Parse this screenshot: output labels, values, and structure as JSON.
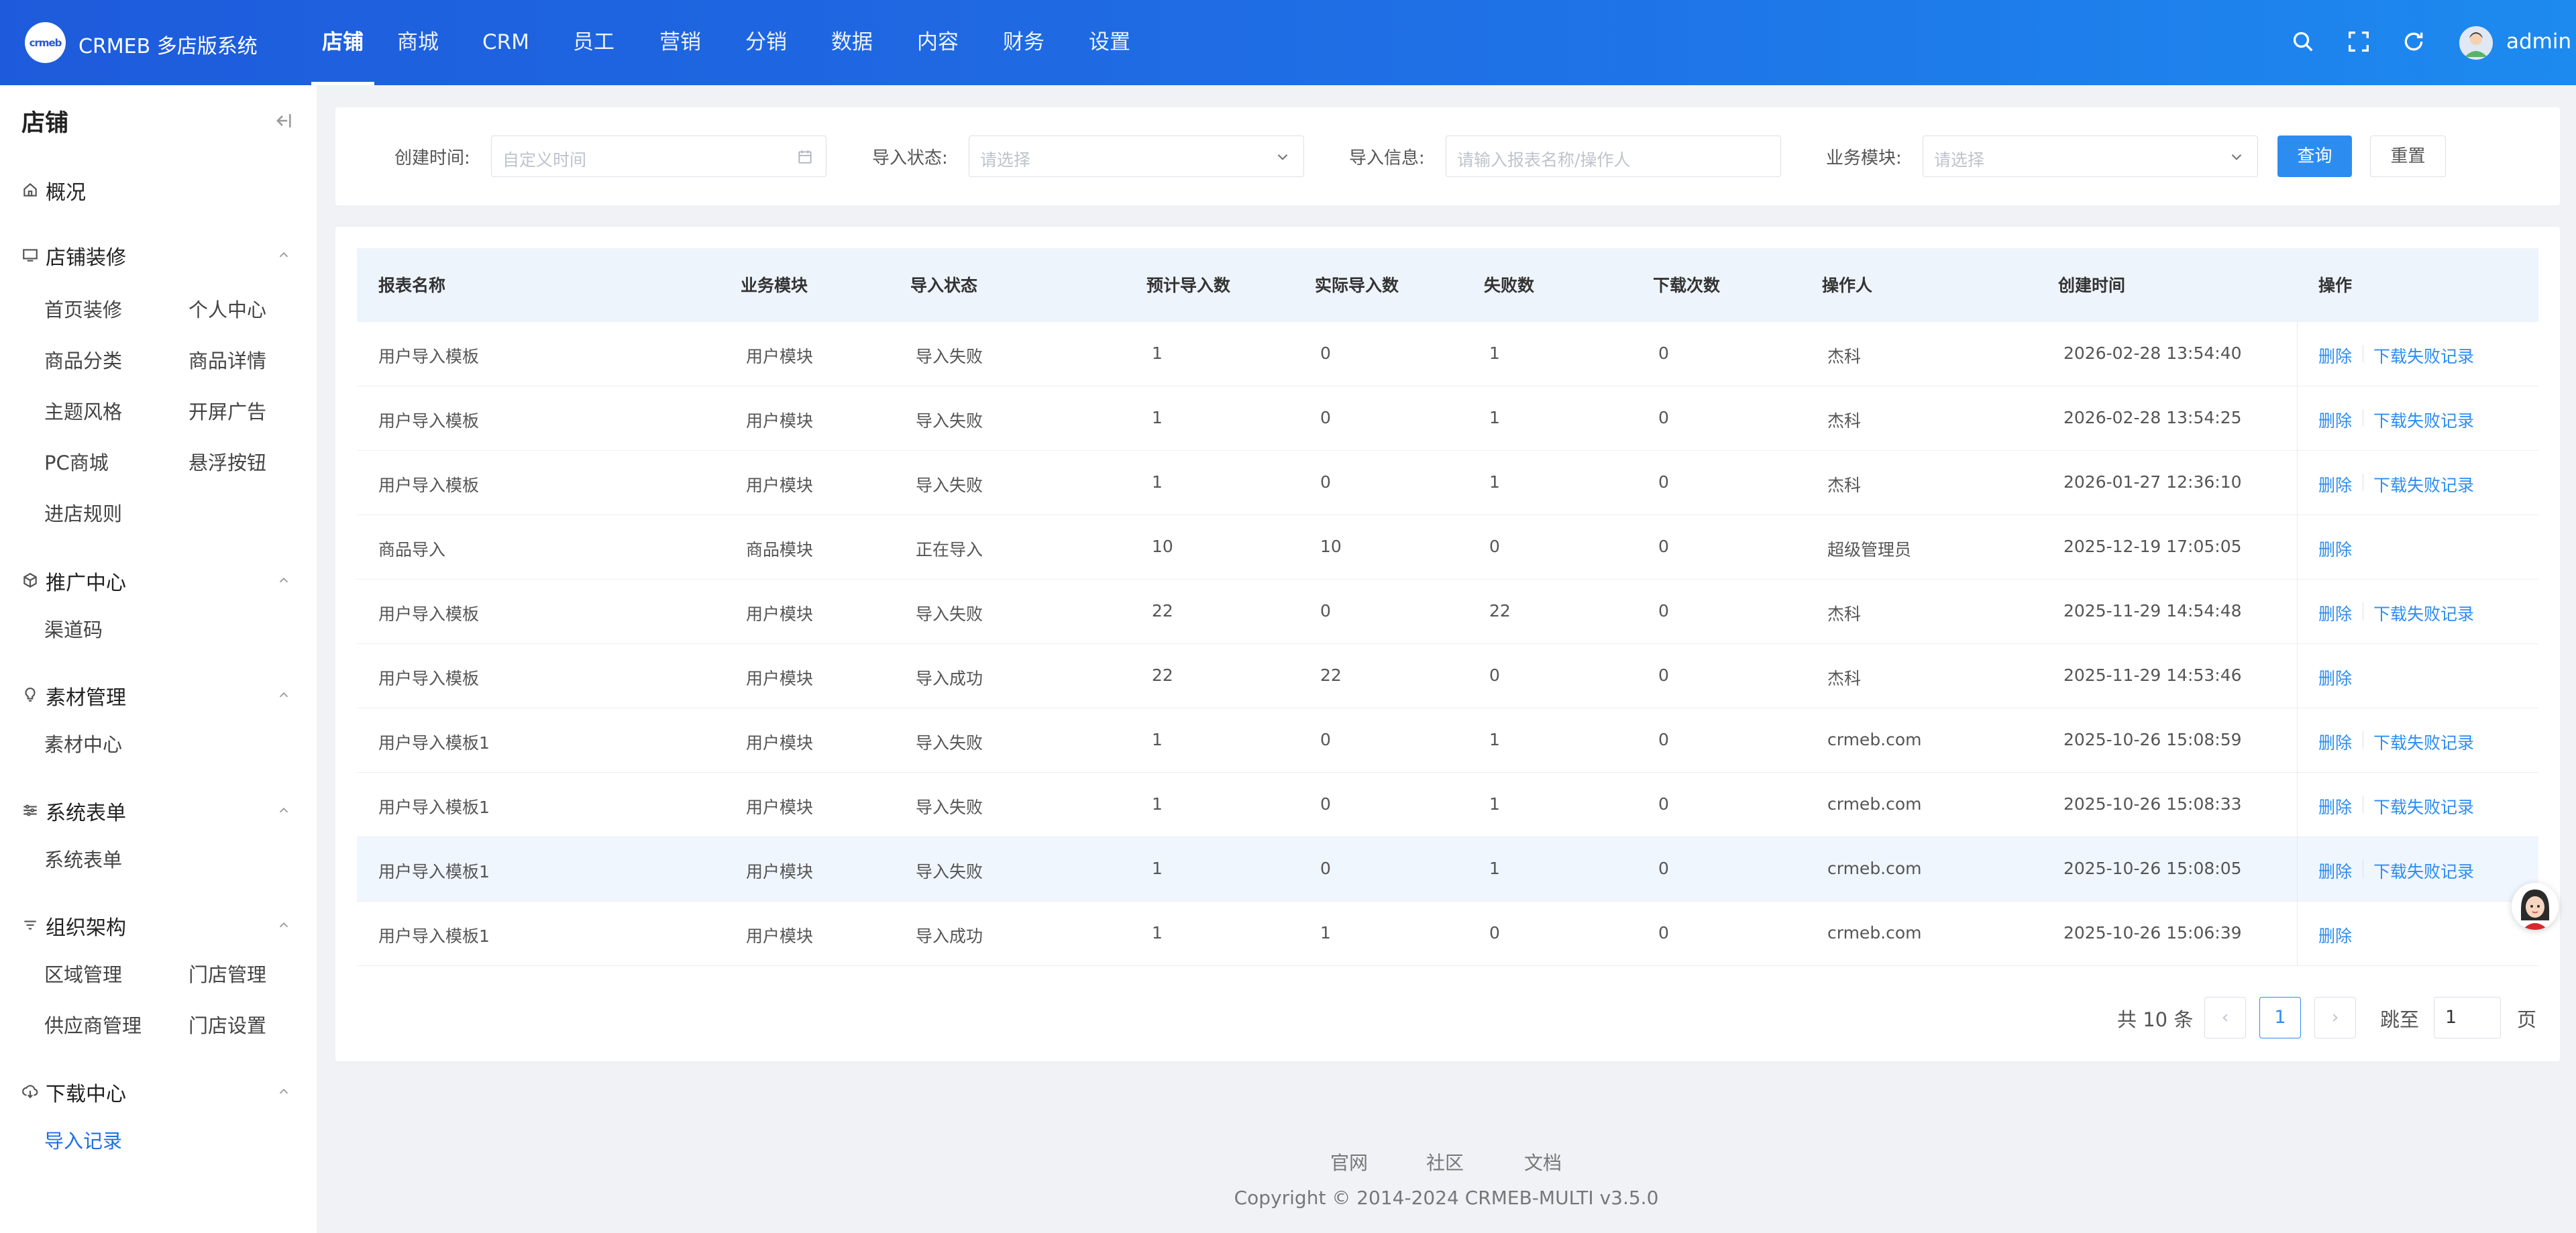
{
  "header": {
    "logo_text": "crmeb",
    "brand": "CRMEB 多店版系统",
    "nav": [
      {
        "label": "店铺",
        "active": true
      },
      {
        "label": "商城"
      },
      {
        "label": "CRM"
      },
      {
        "label": "员工"
      },
      {
        "label": "营销"
      },
      {
        "label": "分销"
      },
      {
        "label": "数据"
      },
      {
        "label": "内容"
      },
      {
        "label": "财务"
      },
      {
        "label": "设置"
      }
    ],
    "icons": [
      "search-icon",
      "fullscreen-icon",
      "refresh-icon"
    ],
    "username": "admin",
    "accent": "#1e5bdc"
  },
  "sidebar": {
    "title": "店铺",
    "groups": [
      {
        "label": "概况",
        "icon": "home-icon"
      },
      {
        "label": "店铺装修",
        "icon": "monitor-icon",
        "items": [
          "首页装修",
          "个人中心",
          "商品分类",
          "商品详情",
          "主题风格",
          "开屏广告",
          "PC商城",
          "悬浮按钮",
          "进店规则"
        ]
      },
      {
        "label": "推广中心",
        "icon": "cube-icon",
        "items": [
          "渠道码"
        ]
      },
      {
        "label": "素材管理",
        "icon": "bulb-icon",
        "items": [
          "素材中心"
        ]
      },
      {
        "label": "系统表单",
        "icon": "sliders-icon",
        "items": [
          "系统表单"
        ]
      },
      {
        "label": "组织架构",
        "icon": "filter-icon",
        "items": [
          "区域管理",
          "门店管理",
          "供应商管理",
          "门店设置"
        ]
      },
      {
        "label": "下载中心",
        "icon": "cloud-download-icon",
        "items": [
          "导入记录"
        ],
        "active_item": "导入记录"
      }
    ]
  },
  "filters": {
    "created_label": "创建时间:",
    "created_placeholder": "自定义时间",
    "status_label": "导入状态:",
    "status_placeholder": "请选择",
    "info_label": "导入信息:",
    "info_placeholder": "请输入报表名称/操作人",
    "module_label": "业务模块:",
    "module_placeholder": "请选择",
    "search_button": "查询",
    "reset_button": "重置"
  },
  "table": {
    "columns": [
      "报表名称",
      "业务模块",
      "导入状态",
      "预计导入数",
      "实际导入数",
      "失败数",
      "下载次数",
      "操作人",
      "创建时间",
      "操作"
    ],
    "delete_label": "删除",
    "download_label": "下载失败记录",
    "rows": [
      {
        "name": "用户导入模板",
        "module": "用户模块",
        "status": "导入失败",
        "expected": "1",
        "actual": "0",
        "failed": "1",
        "downloads": "0",
        "operator": "杰科",
        "created": "2026-02-28 13:54:40",
        "has_download": true
      },
      {
        "name": "用户导入模板",
        "module": "用户模块",
        "status": "导入失败",
        "expected": "1",
        "actual": "0",
        "failed": "1",
        "downloads": "0",
        "operator": "杰科",
        "created": "2026-02-28 13:54:25",
        "has_download": true
      },
      {
        "name": "用户导入模板",
        "module": "用户模块",
        "status": "导入失败",
        "expected": "1",
        "actual": "0",
        "failed": "1",
        "downloads": "0",
        "operator": "杰科",
        "created": "2026-01-27 12:36:10",
        "has_download": true
      },
      {
        "name": "商品导入",
        "module": "商品模块",
        "status": "正在导入",
        "expected": "10",
        "actual": "10",
        "failed": "0",
        "downloads": "0",
        "operator": "超级管理员",
        "created": "2025-12-19 17:05:05",
        "has_download": false
      },
      {
        "name": "用户导入模板",
        "module": "用户模块",
        "status": "导入失败",
        "expected": "22",
        "actual": "0",
        "failed": "22",
        "downloads": "0",
        "operator": "杰科",
        "created": "2025-11-29 14:54:48",
        "has_download": true
      },
      {
        "name": "用户导入模板",
        "module": "用户模块",
        "status": "导入成功",
        "expected": "22",
        "actual": "22",
        "failed": "0",
        "downloads": "0",
        "operator": "杰科",
        "created": "2025-11-29 14:53:46",
        "has_download": false
      },
      {
        "name": "用户导入模板1",
        "module": "用户模块",
        "status": "导入失败",
        "expected": "1",
        "actual": "0",
        "failed": "1",
        "downloads": "0",
        "operator": "crmeb.com",
        "created": "2025-10-26 15:08:59",
        "has_download": true
      },
      {
        "name": "用户导入模板1",
        "module": "用户模块",
        "status": "导入失败",
        "expected": "1",
        "actual": "0",
        "failed": "1",
        "downloads": "0",
        "operator": "crmeb.com",
        "created": "2025-10-26 15:08:33",
        "has_download": true
      },
      {
        "name": "用户导入模板1",
        "module": "用户模块",
        "status": "导入失败",
        "expected": "1",
        "actual": "0",
        "failed": "1",
        "downloads": "0",
        "operator": "crmeb.com",
        "created": "2025-10-26 15:08:05",
        "has_download": true,
        "hover": true
      },
      {
        "name": "用户导入模板1",
        "module": "用户模块",
        "status": "导入成功",
        "expected": "1",
        "actual": "1",
        "failed": "0",
        "downloads": "0",
        "operator": "crmeb.com",
        "created": "2025-10-26 15:06:39",
        "has_download": false
      }
    ]
  },
  "pagination": {
    "total": "共 10 条",
    "prev": "‹",
    "current": "1",
    "next": "›",
    "jump_label": "跳至",
    "jump_value": "1",
    "page_suffix": "页"
  },
  "footer": {
    "links": [
      "官网",
      "社区",
      "文档"
    ],
    "copyright": "Copyright © 2014-2024 CRMEB-MULTI v3.5.0"
  },
  "theme": {
    "primary": "#2d8cf0",
    "header_start": "#1e5bdc",
    "header_end": "#1d8aef",
    "active_menu": "#1e6fe5"
  }
}
